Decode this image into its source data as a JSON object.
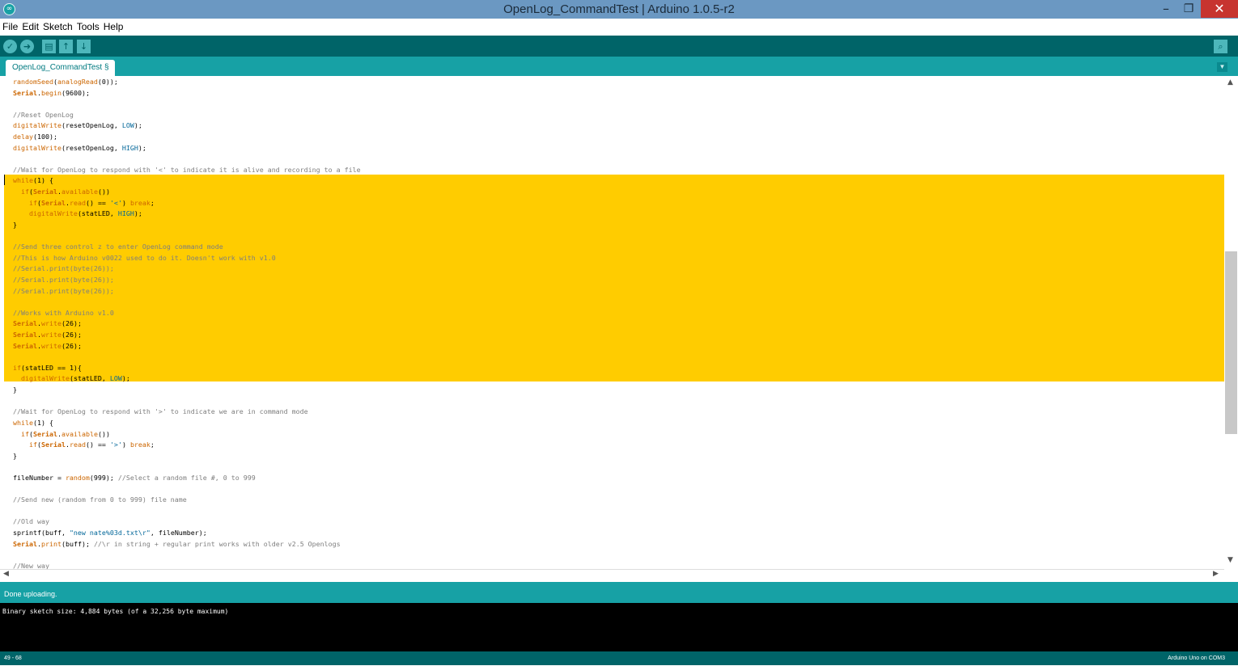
{
  "window": {
    "title": "OpenLog_CommandTest | Arduino 1.0.5-r2"
  },
  "menu": [
    "File",
    "Edit",
    "Sketch",
    "Tools",
    "Help"
  ],
  "toolbar": [
    {
      "name": "verify-button",
      "glyph": "✓"
    },
    {
      "name": "upload-button",
      "glyph": "➜"
    },
    {
      "name": "new-button",
      "glyph": "▤"
    },
    {
      "name": "open-button",
      "glyph": "↑"
    },
    {
      "name": "save-button",
      "glyph": "↓"
    }
  ],
  "serial_monitor_glyph": "⌕",
  "tab": {
    "label": "OpenLog_CommandTest §"
  },
  "editor": {
    "lines": [
      [
        [
          "randomSeed",
          "kw"
        ],
        [
          "(",
          ""
        ],
        [
          "analogRead",
          "kw"
        ],
        [
          "(0));",
          ""
        ]
      ],
      [
        [
          "Serial",
          "bo"
        ],
        [
          ".",
          ""
        ],
        [
          "begin",
          "kw"
        ],
        [
          "(9600);",
          ""
        ]
      ],
      [],
      [
        [
          "//Reset OpenLog",
          "cm"
        ]
      ],
      [
        [
          "digitalWrite",
          "kw"
        ],
        [
          "(resetOpenLog, ",
          ""
        ],
        [
          "LOW",
          "cn"
        ],
        [
          ");",
          ""
        ]
      ],
      [
        [
          "delay",
          "kw"
        ],
        [
          "(100);",
          ""
        ]
      ],
      [
        [
          "digitalWrite",
          "kw"
        ],
        [
          "(resetOpenLog, ",
          ""
        ],
        [
          "HIGH",
          "cn"
        ],
        [
          ");",
          ""
        ]
      ],
      [],
      [
        [
          "//Wait for OpenLog to respond with '<' to indicate it is alive and recording to a file",
          "cm"
        ]
      ],
      [
        [
          "while",
          "kw"
        ],
        [
          "(1) {",
          ""
        ]
      ],
      [
        [
          "  ",
          ""
        ],
        [
          "if",
          "kw"
        ],
        [
          "(",
          ""
        ],
        [
          "Serial",
          "bo"
        ],
        [
          ".",
          ""
        ],
        [
          "available",
          "kw"
        ],
        [
          "())",
          ""
        ]
      ],
      [
        [
          "    ",
          ""
        ],
        [
          "if",
          "kw"
        ],
        [
          "(",
          ""
        ],
        [
          "Serial",
          "bo"
        ],
        [
          ".",
          ""
        ],
        [
          "read",
          "kw"
        ],
        [
          "() == ",
          ""
        ],
        [
          "'<'",
          "st"
        ],
        [
          ") ",
          ""
        ],
        [
          "break",
          "kw"
        ],
        [
          ";",
          ""
        ]
      ],
      [
        [
          "    ",
          ""
        ],
        [
          "digitalWrite",
          "kw"
        ],
        [
          "(statLED, ",
          ""
        ],
        [
          "HIGH",
          "cn"
        ],
        [
          ");",
          ""
        ]
      ],
      [
        [
          "}",
          ""
        ]
      ],
      [],
      [
        [
          "//Send three control z to enter OpenLog command mode",
          "cm"
        ]
      ],
      [
        [
          "//This is how Arduino v0022 used to do it. Doesn't work with v1.0",
          "cm"
        ]
      ],
      [
        [
          "//Serial.print(byte(26));",
          "cm"
        ]
      ],
      [
        [
          "//Serial.print(byte(26));",
          "cm"
        ]
      ],
      [
        [
          "//Serial.print(byte(26));",
          "cm"
        ]
      ],
      [],
      [
        [
          "//Works with Arduino v1.0",
          "cm"
        ]
      ],
      [
        [
          "Serial",
          "bo"
        ],
        [
          ".",
          ""
        ],
        [
          "write",
          "kw"
        ],
        [
          "(26);",
          ""
        ]
      ],
      [
        [
          "Serial",
          "bo"
        ],
        [
          ".",
          ""
        ],
        [
          "write",
          "kw"
        ],
        [
          "(26);",
          ""
        ]
      ],
      [
        [
          "Serial",
          "bo"
        ],
        [
          ".",
          ""
        ],
        [
          "write",
          "kw"
        ],
        [
          "(26);",
          ""
        ]
      ],
      [],
      [
        [
          "if",
          "kw"
        ],
        [
          "(statLED == 1){",
          ""
        ]
      ],
      [
        [
          "  ",
          ""
        ],
        [
          "digitalWrite",
          "kw"
        ],
        [
          "(statLED, ",
          ""
        ],
        [
          "LOW",
          "cn"
        ],
        [
          ");",
          ""
        ]
      ],
      [
        [
          "}",
          ""
        ]
      ],
      [],
      [
        [
          "//Wait for OpenLog to respond with '>' to indicate we are in command mode",
          "cm"
        ]
      ],
      [
        [
          "while",
          "kw"
        ],
        [
          "(1) {",
          ""
        ]
      ],
      [
        [
          "  ",
          ""
        ],
        [
          "if",
          "kw"
        ],
        [
          "(",
          ""
        ],
        [
          "Serial",
          "bo"
        ],
        [
          ".",
          ""
        ],
        [
          "available",
          "kw"
        ],
        [
          "())",
          ""
        ]
      ],
      [
        [
          "    ",
          ""
        ],
        [
          "if",
          "kw"
        ],
        [
          "(",
          ""
        ],
        [
          "Serial",
          "bo"
        ],
        [
          ".",
          ""
        ],
        [
          "read",
          "kw"
        ],
        [
          "() == ",
          ""
        ],
        [
          "'>'",
          "st"
        ],
        [
          ") ",
          ""
        ],
        [
          "break",
          "kw"
        ],
        [
          ";",
          ""
        ]
      ],
      [
        [
          "}",
          ""
        ]
      ],
      [],
      [
        [
          "fileNumber = ",
          ""
        ],
        [
          "random",
          "kw"
        ],
        [
          "(999); ",
          ""
        ],
        [
          "//Select a random file #, 0 to 999",
          "cm"
        ]
      ],
      [],
      [
        [
          "//Send new (random from 0 to 999) file name",
          "cm"
        ]
      ],
      [],
      [
        [
          "//Old way",
          "cm"
        ]
      ],
      [
        [
          "sprintf(buff, ",
          ""
        ],
        [
          "\"new nate%03d.txt\\r\"",
          "st"
        ],
        [
          ", fileNumber);",
          ""
        ]
      ],
      [
        [
          "Serial",
          "bo"
        ],
        [
          ".",
          ""
        ],
        [
          "print",
          "kw"
        ],
        [
          "(buff); ",
          ""
        ],
        [
          "//\\r in string + regular print works with older v2.5 Openlogs",
          "cm"
        ]
      ],
      [],
      [
        [
          "//New way",
          "cm"
        ]
      ]
    ]
  },
  "status": {
    "message": "Done uploading."
  },
  "console": {
    "output": "Binary sketch size: 4,884 bytes (of a 32,256 byte maximum)"
  },
  "footer": {
    "line_number": "49 - 68",
    "board": "Arduino Uno on COM3"
  }
}
